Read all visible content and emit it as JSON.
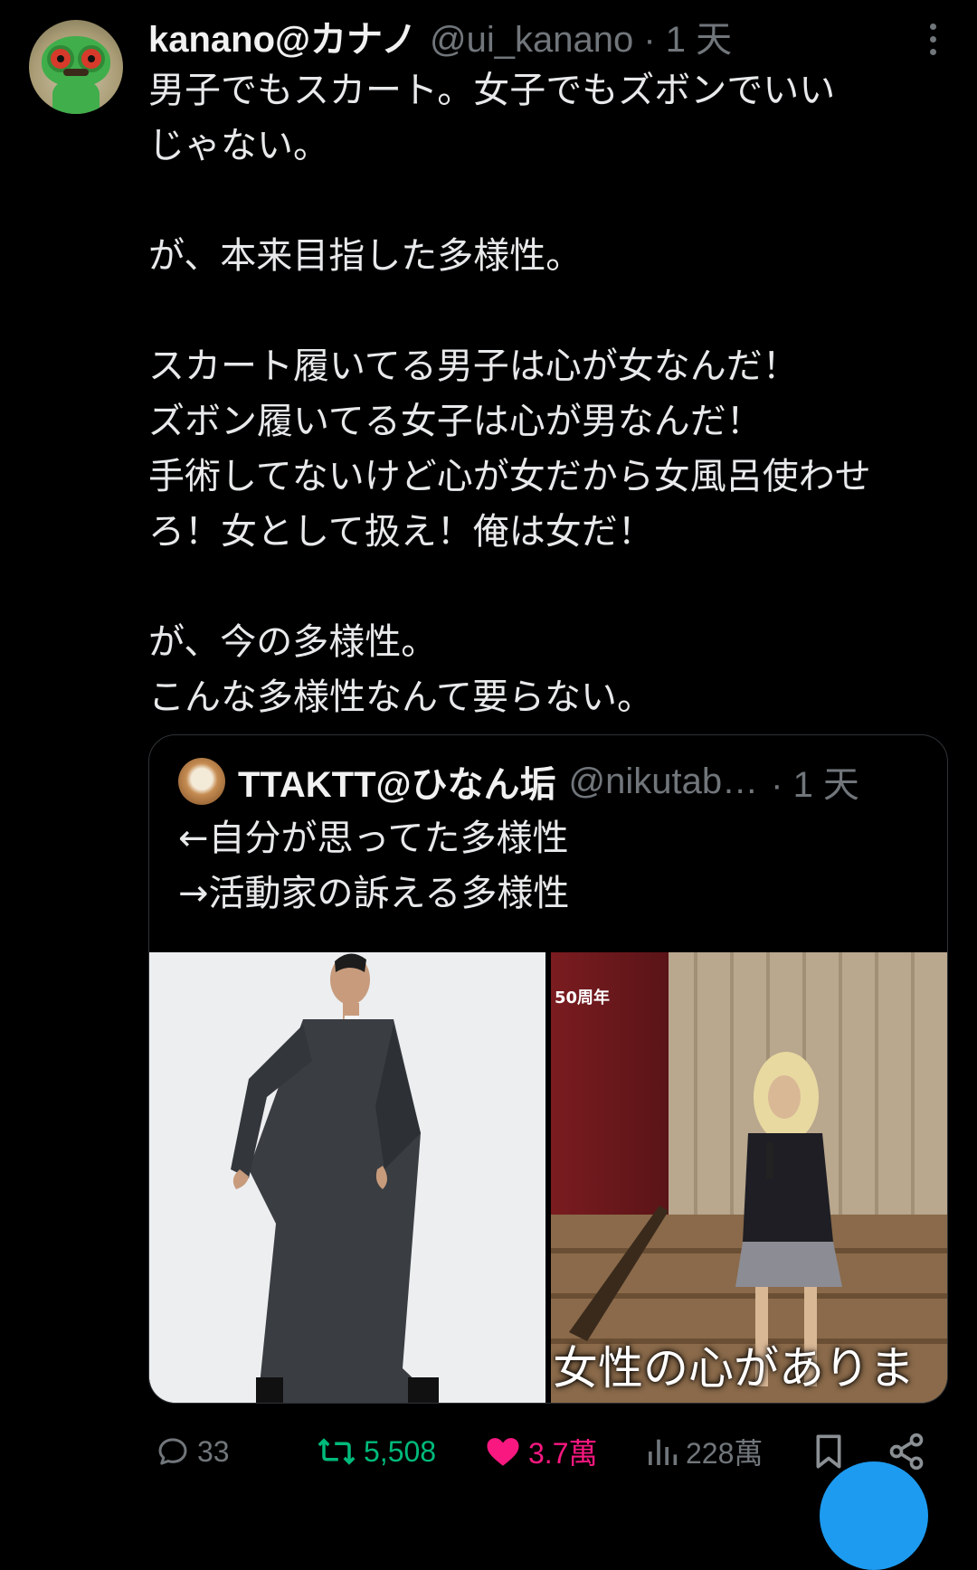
{
  "tweet": {
    "name": "kanano@カナノ",
    "handle": "@ui_kanano · 1 天",
    "text": "男子でもスカート。女子でもズボンでいい\nじゃない。\n\nが、本来目指した多様性。\n\nスカート履いてる男子は心が女なんだ！\nズボン履いてる女子は心が男なんだ！\n手術してないけど心が女だから女風呂使わせ\nろ！女として扱え！俺は女だ！\n\nが、今の多様性。\nこんな多様性なんて要らない。"
  },
  "quote": {
    "name": "TTAKTT@ひなん垢",
    "handle": "@nikutab…",
    "time": "· 1 天",
    "text": "←自分が思ってた多様性\n→活動家の訴える多様性",
    "image2_overlay_top": "50周年",
    "image2_caption": "女性の心がありま"
  },
  "actions": {
    "replies": "33",
    "retweets": "5,508",
    "likes": "3.7萬",
    "views": "228萬"
  },
  "colors": {
    "background": "#000000",
    "text": "#e7e9ea",
    "muted": "#71767b",
    "retweet": "#00ba7c",
    "like": "#f91880",
    "accent": "#1d9bf0"
  }
}
